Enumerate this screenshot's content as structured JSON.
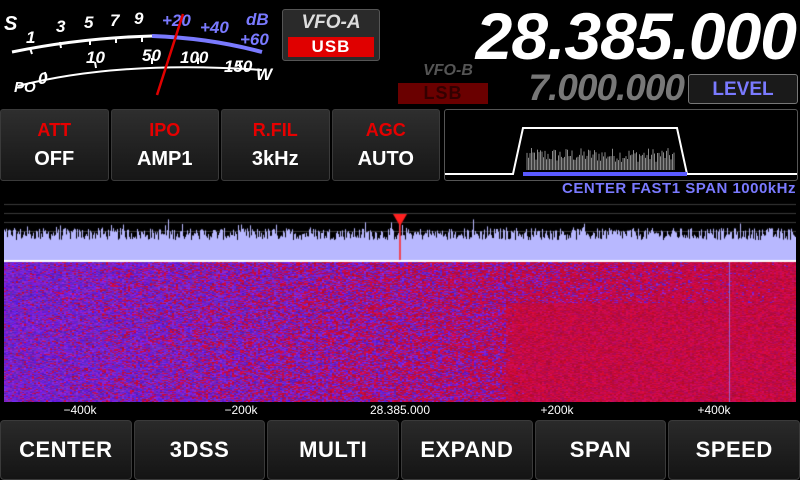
{
  "meter": {
    "s_label": "S",
    "s_scale": [
      "1",
      "3",
      "5",
      "7",
      "9"
    ],
    "plus_scale": [
      "+20",
      "+40",
      "+60"
    ],
    "db_label": "dB",
    "po_label": "PO",
    "po_scale": [
      "0",
      "10",
      "50",
      "100",
      "150"
    ],
    "w_label": "W"
  },
  "vfo_a": {
    "label": "VFO-A",
    "mode": "USB",
    "frequency": "28.385.000"
  },
  "vfo_b": {
    "label": "VFO-B",
    "mode": "LSB",
    "frequency": "7.000.000"
  },
  "level_button": "LEVEL",
  "functions": [
    {
      "name": "ATT",
      "value": "OFF"
    },
    {
      "name": "IPO",
      "value": "AMP1"
    },
    {
      "name": "R.FIL",
      "value": "3kHz"
    },
    {
      "name": "AGC",
      "value": "AUTO"
    }
  ],
  "scope_info": "CENTER  FAST1   SPAN  1000kHz",
  "freq_axis": [
    "−400k",
    "−200k",
    "28.385.000",
    "+200k",
    "+400k"
  ],
  "bottom_buttons": [
    "CENTER",
    "3DSS",
    "MULTI",
    "EXPAND",
    "SPAN",
    "SPEED"
  ],
  "colors": {
    "accent_red": "#e00000",
    "accent_blue": "#7a7aff",
    "spectrum_fill": "#b8b8ff",
    "waterfall_red": "#c0102a",
    "waterfall_blue": "#4a28c8"
  }
}
